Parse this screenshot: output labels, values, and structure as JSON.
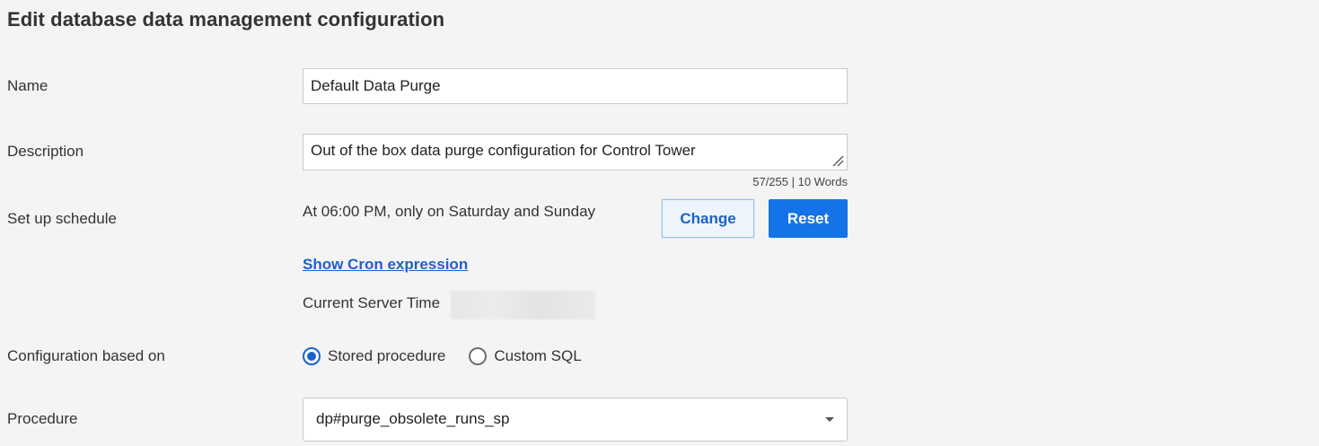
{
  "page": {
    "title": "Edit database data management configuration"
  },
  "form": {
    "name": {
      "label": "Name",
      "value": "Default Data Purge"
    },
    "description": {
      "label": "Description",
      "value": "Out of the box data purge configuration for Control Tower",
      "counter": "57/255 | 10 Words"
    },
    "schedule": {
      "label": "Set up schedule",
      "summary": "At 06:00 PM, only on Saturday and Sunday",
      "change_label": "Change",
      "reset_label": "Reset",
      "cron_link": "Show Cron expression",
      "server_time_label": "Current Server Time"
    },
    "configuration": {
      "label": "Configuration based on",
      "options": [
        {
          "label": "Stored procedure",
          "checked": true
        },
        {
          "label": "Custom SQL",
          "checked": false
        }
      ]
    },
    "procedure": {
      "label": "Procedure",
      "selected": "dp#purge_obsolete_runs_sp"
    }
  },
  "colors": {
    "background": "#f4f4f4",
    "primary": "#1473e6",
    "link": "#1a63c9",
    "text": "#333333",
    "border": "#c9c9c9"
  },
  "icons": {
    "resize": "resize-grip-icon",
    "dropdown": "caret-down-icon",
    "radio_checked": "radio-checked-icon",
    "radio_unchecked": "radio-unchecked-icon"
  }
}
